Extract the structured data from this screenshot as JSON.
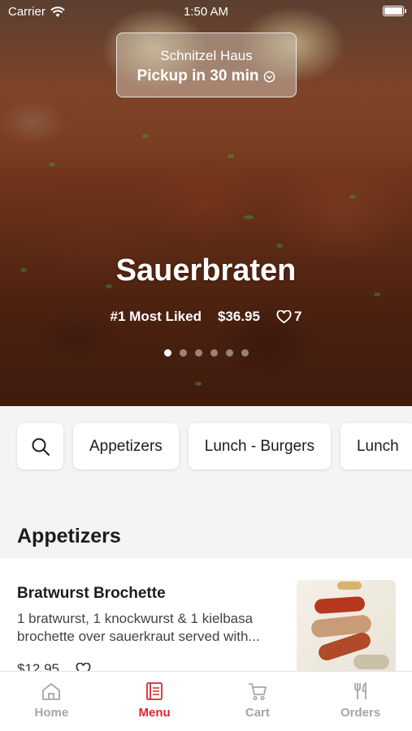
{
  "status_bar": {
    "carrier": "Carrier",
    "time": "1:50 AM"
  },
  "header": {
    "restaurant": "Schnitzel Haus",
    "pickup_label": "Pickup in 30 min"
  },
  "featured": {
    "title": "Sauerbraten",
    "rank": "#1 Most Liked",
    "price": "$36.95",
    "likes": "7",
    "slide_count": 6,
    "active_slide": 1
  },
  "categories": [
    "Appetizers",
    "Lunch - Burgers",
    "Lunch"
  ],
  "section_title": "Appetizers",
  "items": [
    {
      "name": "Bratwurst Brochette",
      "description": "1 bratwurst, 1 knockwurst & 1 kielbasa brochette over sauerkraut served with...",
      "price": "$12.95"
    }
  ],
  "tabs": [
    {
      "label": "Home",
      "icon": "home-icon",
      "active": false
    },
    {
      "label": "Menu",
      "icon": "menu-book-icon",
      "active": true
    },
    {
      "label": "Cart",
      "icon": "cart-icon",
      "active": false
    },
    {
      "label": "Orders",
      "icon": "fork-knife-icon",
      "active": false
    }
  ],
  "colors": {
    "accent": "#d7282f",
    "inactive_tab": "#a6a6a6"
  }
}
